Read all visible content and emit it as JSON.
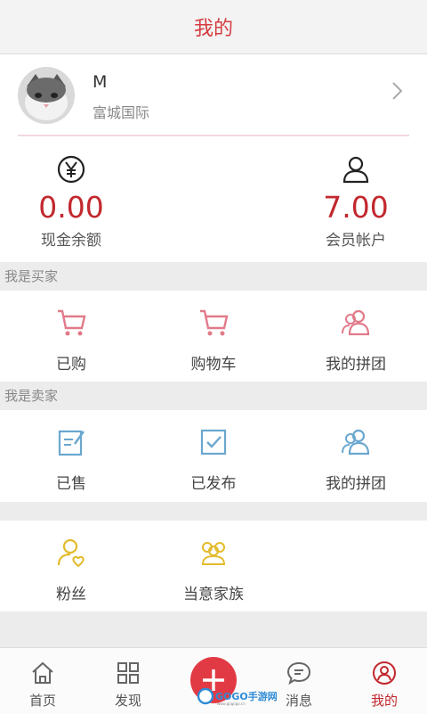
{
  "header": {
    "title": "我的"
  },
  "profile": {
    "name": "M",
    "subtitle": "富城国际"
  },
  "stats": [
    {
      "value": "0.00",
      "label": "现金余额",
      "icon": "yen-icon"
    },
    {
      "value": "7.00",
      "label": "会员帐户",
      "icon": "user-icon"
    }
  ],
  "buyer": {
    "label": "我是买家",
    "items": [
      {
        "label": "已购",
        "icon": "cart-icon"
      },
      {
        "label": "购物车",
        "icon": "cart-icon"
      },
      {
        "label": "我的拼团",
        "icon": "group-icon"
      }
    ]
  },
  "seller": {
    "label": "我是卖家",
    "items": [
      {
        "label": "已售",
        "icon": "edit-icon"
      },
      {
        "label": "已发布",
        "icon": "check-icon"
      },
      {
        "label": "我的拼团",
        "icon": "group-icon"
      }
    ]
  },
  "social": {
    "items": [
      {
        "label": "粉丝",
        "icon": "fan-icon"
      },
      {
        "label": "当意家族",
        "icon": "family-icon"
      }
    ]
  },
  "tabbar": [
    {
      "label": "首页",
      "icon": "home-icon"
    },
    {
      "label": "发现",
      "icon": "grid-icon"
    },
    {
      "label": "",
      "icon": "plus-icon"
    },
    {
      "label": "消息",
      "icon": "chat-icon"
    },
    {
      "label": "我的",
      "icon": "profile-icon"
    }
  ],
  "watermark": {
    "text": "GOGO手游网",
    "url": "www.gogogo.cn"
  },
  "colors": {
    "accent": "#c2282e",
    "pink": "#e27a8a",
    "blue": "#6aa7cf",
    "yellow": "#e3bb2b"
  }
}
